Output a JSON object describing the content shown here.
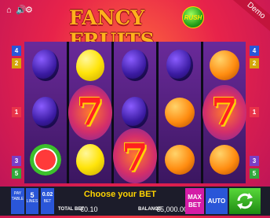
{
  "top_icons": {
    "home": "⌂",
    "sound": "🔊",
    "settings": "⚙"
  },
  "logo": {
    "text": "FANCY FRUITS",
    "badge": "RUSH"
  },
  "demo_label": "Demo",
  "line_numbers": {
    "left": [
      "4",
      "2",
      "1",
      "3",
      "5"
    ],
    "right": [
      "4",
      "2",
      "1",
      "3",
      "5"
    ]
  },
  "reels": [
    [
      "plum",
      "plum",
      "watermelon"
    ],
    [
      "lemon",
      "seven",
      "lemon"
    ],
    [
      "plum",
      "plum",
      "seven"
    ],
    [
      "plum",
      "orange",
      "orange"
    ],
    [
      "orange",
      "seven",
      "orange"
    ]
  ],
  "bottom": {
    "info": [
      "PAY",
      "TABLE"
    ],
    "lines_value": "5",
    "lines_label": "LINES",
    "bet_value": "0.02",
    "bet_label": "BET",
    "message": "Choose your BET",
    "total_bet_label": "TOTAL BET",
    "total_bet_value": "€0.10",
    "balance_label": "BALANCE",
    "balance_value": "€5,000.00",
    "max_bet_line1": "MAX",
    "max_bet_line2": "BET",
    "auto_label": "AUTO"
  },
  "colors": {
    "line_colors_left": [
      "#2a56d8",
      "#d4a50a",
      "#e8344a",
      "#7a3fc6",
      "#32a83c"
    ],
    "line_colors_right": [
      "#2a56d8",
      "#d4a50a",
      "#e8344a",
      "#7a3fc6",
      "#32a83c"
    ]
  }
}
